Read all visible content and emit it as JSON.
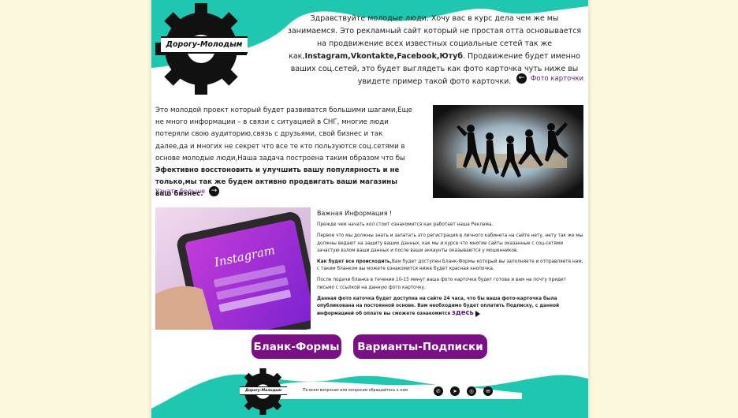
{
  "logo": {
    "text": "Дорогу-Молодым"
  },
  "intro": {
    "part1": "Здравствуйте молодые люди. Хочу вас в курс дела чем же мы занимаемся. Это рекламный сайт который не простая отта основывается на продвижение всех известных социальные сетей так же как,",
    "socials": "Instagram,Vkontakte,Facebook,Ютуб",
    "part2": ". Продвижение будет именно ваших соц.сетей, это будет выглядеть как фото карточка чуть ниже вы увидете пример такой фото карточки."
  },
  "photo_link": {
    "label": "Фото карточки"
  },
  "about": {
    "text": "Это молодой проект который будет развиватся большими шагами,Еще не много информации – в связи с ситуацией в СНГ, многие люди потеряли свою аудиторию,связь с друзьями, свой бизнес и так далее,да и многих не секрет что все те кто пользуются соц.сетями в основе молодые люди,Наша задача построена таким образом что бы ",
    "bold": "Эфективно восстоновить и улучшить вашу популярность и не только,мы так же будем активно продвигать ваши магазины ваш бизнес."
  },
  "more_link": {
    "label": "Узнать больше"
  },
  "info": {
    "title": "Важная Информация !",
    "p1": "Прежде чем начать кол стоит ознакомится как работает наша Реклама.",
    "p2": "Первое что мы должны знать и запатать это регистрация в личного кабинета на сайте нету, нету так же мы должны ведают на защиту ваших данных, как мы и курсе что многие сайты оказанные с соц-сетями зачастую взлом ваши данных и после ваши аккаунты оказываются у мошенников.",
    "p3_bold": "Как будет все происходить,",
    "p3": "Вам будет доступен Бланк-Формы который вы заполняете и отправляете нам, с таким бланком вы можете ознакомится ниже будет красная кнопочка.",
    "p4": "После подачи бланка в течении 10-15 минут ваша фото карточка будет готова и вам на почту придет письмо с ссылкой на данную фото карточку.",
    "p5_bold": "Данная фото каточка будет доступна на сайте 24 часа, что бы ваша фото-карточка была опубликована на постоянной основе. Вам необходимо будет оплатить Подписку, с данной информацией об оплате вы сможете ознакомится",
    "here": "здесь"
  },
  "buttons": {
    "forms": "Бланк-Формы",
    "subs": "Варианты-Подписки"
  },
  "footer": {
    "text": "По всем вопросам или вопросам обращайтесь к нам"
  },
  "social_icons": [
    "whatsapp-icon",
    "telegram-icon",
    "instagram-icon",
    "mail-icon"
  ],
  "colors": {
    "accent": "#1ec7b0",
    "button": "#7a0f86",
    "background": "#fbf8dd"
  },
  "images": {
    "group_photo": "people jumping silhouettes in tunnel",
    "insta_photo": "hand holding phone with Instagram app"
  }
}
